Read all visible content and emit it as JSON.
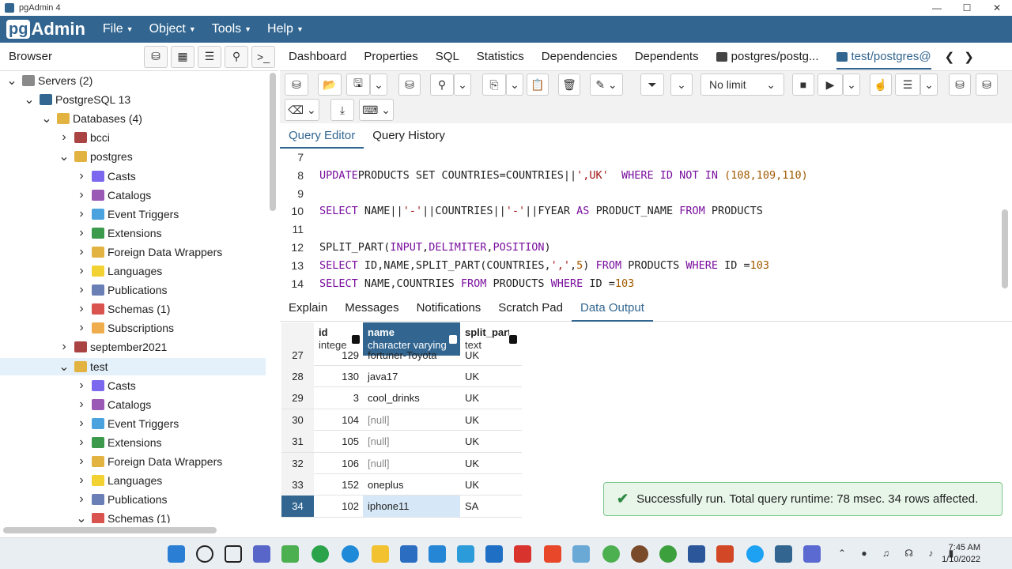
{
  "window": {
    "title": "pgAdmin 4",
    "controls": [
      "—",
      "☐",
      "✕"
    ]
  },
  "menubar": {
    "logo_pg": "pg",
    "logo_admin": "Admin",
    "items": [
      "File",
      "Object",
      "Tools",
      "Help"
    ]
  },
  "browser": {
    "title": "Browser"
  },
  "tree": [
    {
      "label": "Servers (2)",
      "level": 0,
      "toggle": "v",
      "icon_color": "#8a8a8a"
    },
    {
      "label": "PostgreSQL 13",
      "level": 1,
      "toggle": "v",
      "icon_color": "#336791"
    },
    {
      "label": "Databases (4)",
      "level": 2,
      "toggle": "v",
      "icon_color": "#e3b341"
    },
    {
      "label": "bcci",
      "level": 3,
      "toggle": ">",
      "icon_color": "#a94442"
    },
    {
      "label": "postgres",
      "level": 3,
      "toggle": "v",
      "icon_color": "#e3b341"
    },
    {
      "label": "Casts",
      "level": 4,
      "toggle": ">",
      "icon_color": "#7b68ee"
    },
    {
      "label": "Catalogs",
      "level": 4,
      "toggle": ">",
      "icon_color": "#9b59b6"
    },
    {
      "label": "Event Triggers",
      "level": 4,
      "toggle": ">",
      "icon_color": "#4aa3df"
    },
    {
      "label": "Extensions",
      "level": 4,
      "toggle": ">",
      "icon_color": "#3c9a4c"
    },
    {
      "label": "Foreign Data Wrappers",
      "level": 4,
      "toggle": ">",
      "icon_color": "#e3b341"
    },
    {
      "label": "Languages",
      "level": 4,
      "toggle": ">",
      "icon_color": "#f2d233"
    },
    {
      "label": "Publications",
      "level": 4,
      "toggle": ">",
      "icon_color": "#6a7fb5"
    },
    {
      "label": "Schemas (1)",
      "level": 4,
      "toggle": ">",
      "icon_color": "#d9534f"
    },
    {
      "label": "Subscriptions",
      "level": 4,
      "toggle": ">",
      "icon_color": "#f0ad4e"
    },
    {
      "label": "september2021",
      "level": 3,
      "toggle": ">",
      "icon_color": "#a94442"
    },
    {
      "label": "test",
      "level": 3,
      "toggle": "v",
      "icon_color": "#e3b341",
      "selected": true
    },
    {
      "label": "Casts",
      "level": 4,
      "toggle": ">",
      "icon_color": "#7b68ee"
    },
    {
      "label": "Catalogs",
      "level": 4,
      "toggle": ">",
      "icon_color": "#9b59b6"
    },
    {
      "label": "Event Triggers",
      "level": 4,
      "toggle": ">",
      "icon_color": "#4aa3df"
    },
    {
      "label": "Extensions",
      "level": 4,
      "toggle": ">",
      "icon_color": "#3c9a4c"
    },
    {
      "label": "Foreign Data Wrappers",
      "level": 4,
      "toggle": ">",
      "icon_color": "#e3b341"
    },
    {
      "label": "Languages",
      "level": 4,
      "toggle": ">",
      "icon_color": "#f2d233"
    },
    {
      "label": "Publications",
      "level": 4,
      "toggle": ">",
      "icon_color": "#6a7fb5"
    },
    {
      "label": "Schemas (1)",
      "level": 4,
      "toggle": "v",
      "icon_color": "#d9534f"
    }
  ],
  "main_tabs": [
    "Dashboard",
    "Properties",
    "SQL",
    "Statistics",
    "Dependencies",
    "Dependents",
    "postgres/postg...",
    "test/postgres@"
  ],
  "toolbar": {
    "limit_label": "No limit"
  },
  "query_tabs": [
    "Query Editor",
    "Query History"
  ],
  "editor_lines": [
    {
      "n": "7",
      "tokens": []
    },
    {
      "n": "8",
      "tokens": [
        [
          "kw",
          "UPDATE"
        ],
        [
          "",
          "PRODUCTS SET COUNTRIES=COUNTRIES||"
        ],
        [
          "str",
          "',UK'"
        ],
        [
          "",
          "  "
        ],
        [
          "kw",
          "WHERE"
        ],
        [
          "",
          ""
        ],
        [
          "kw",
          " ID NOT IN "
        ],
        [
          "num",
          "(108,109,110)"
        ]
      ]
    },
    {
      "n": "9",
      "tokens": []
    },
    {
      "n": "10",
      "tokens": [
        [
          "kw",
          "SELECT"
        ],
        [
          "",
          " NAME||"
        ],
        [
          "str",
          "'-'"
        ],
        [
          "",
          "||COUNTRIES||"
        ],
        [
          "str",
          "'-'"
        ],
        [
          "",
          "||FYEAR "
        ],
        [
          "kw",
          "AS"
        ],
        [
          "",
          " PRODUCT_NAME "
        ],
        [
          "kw",
          "FROM"
        ],
        [
          "",
          " PRODUCTS"
        ]
      ]
    },
    {
      "n": "11",
      "tokens": []
    },
    {
      "n": "12",
      "tokens": [
        [
          "",
          "SPLIT_PART("
        ],
        [
          "kw",
          "INPUT"
        ],
        [
          "",
          ","
        ],
        [
          "kw",
          "DELIMITER"
        ],
        [
          "",
          ","
        ],
        [
          "kw",
          "POSITION"
        ],
        [
          "",
          ")"
        ]
      ]
    },
    {
      "n": "13",
      "tokens": [
        [
          "kw",
          "SELECT"
        ],
        [
          "",
          " ID,NAME,SPLIT_PART(COUNTRIES,"
        ],
        [
          "str",
          "','"
        ],
        [
          "",
          ","
        ],
        [
          "num",
          "5"
        ],
        [
          "",
          ") "
        ],
        [
          "kw",
          "FROM"
        ],
        [
          "",
          " PRODUCTS "
        ],
        [
          "kw",
          "WHERE"
        ],
        [
          "",
          " ID ="
        ],
        [
          "num",
          "103"
        ]
      ]
    },
    {
      "n": "14",
      "tokens": [
        [
          "kw",
          "SELECT"
        ],
        [
          "",
          " NAME,COUNTRIES "
        ],
        [
          "kw",
          "FROM"
        ],
        [
          "",
          " PRODUCTS "
        ],
        [
          "kw",
          "WHERE"
        ],
        [
          "",
          " ID ="
        ],
        [
          "num",
          "103"
        ]
      ]
    }
  ],
  "result_tabs": [
    "Explain",
    "Messages",
    "Notifications",
    "Scratch Pad",
    "Data Output"
  ],
  "grid": {
    "columns": [
      {
        "name": "id",
        "type": "integer"
      },
      {
        "name": "name",
        "type": "character varying"
      },
      {
        "name": "split_part",
        "type": "text"
      }
    ],
    "rows": [
      {
        "rn": "27",
        "id": "129",
        "name": "fortuner-Toyota",
        "split": "UK"
      },
      {
        "rn": "28",
        "id": "130",
        "name": "java17",
        "split": "UK"
      },
      {
        "rn": "29",
        "id": "3",
        "name": "cool_drinks",
        "split": "UK"
      },
      {
        "rn": "30",
        "id": "104",
        "name": "[null]",
        "split": "UK"
      },
      {
        "rn": "31",
        "id": "105",
        "name": "[null]",
        "split": "UK"
      },
      {
        "rn": "32",
        "id": "106",
        "name": "[null]",
        "split": "UK"
      },
      {
        "rn": "33",
        "id": "152",
        "name": "oneplus",
        "split": "UK"
      },
      {
        "rn": "34",
        "id": "102",
        "name": "iphone11",
        "split": "SA"
      }
    ]
  },
  "toast": {
    "icon": "✔",
    "message": "Successfully run. Total query runtime: 78 msec. 34 rows affected."
  },
  "taskbar": {
    "time": "7:45 AM",
    "date": "1/10/2022"
  }
}
